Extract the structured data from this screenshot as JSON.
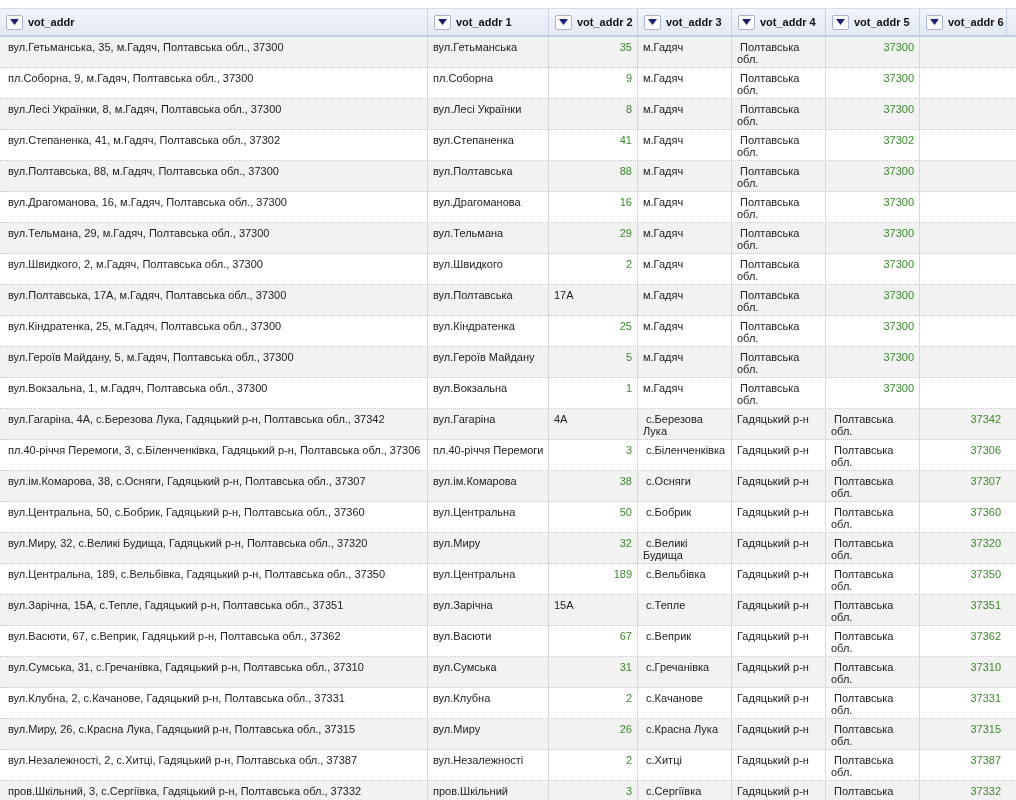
{
  "table": {
    "columns": [
      "vot_addr",
      "vot_addr 1",
      "vot_addr 2",
      "vot_addr 3",
      "vot_addr 4",
      "vot_addr 5",
      "vot_addr 6"
    ],
    "rows": [
      {
        "cells": [
          {
            "text": "вул.Гетьманська, 35, м.Гадяч, Полтавська обл., 37300",
            "kind": "text"
          },
          {
            "text": "вул.Гетьманська",
            "kind": "text"
          },
          {
            "text": "35",
            "kind": "number"
          },
          {
            "text": "м.Гадяч",
            "kind": "text"
          },
          {
            "text": " Полтавська обл.",
            "kind": "text"
          },
          {
            "text": "37300",
            "kind": "number"
          },
          null
        ]
      },
      {
        "cells": [
          {
            "text": "пл.Соборна, 9, м.Гадяч, Полтавська обл., 37300",
            "kind": "text"
          },
          {
            "text": "пл.Соборна",
            "kind": "text"
          },
          {
            "text": "9",
            "kind": "number"
          },
          {
            "text": "м.Гадяч",
            "kind": "text"
          },
          {
            "text": " Полтавська обл.",
            "kind": "text"
          },
          {
            "text": "37300",
            "kind": "number"
          },
          null
        ]
      },
      {
        "cells": [
          {
            "text": "вул.Лесі Українки, 8, м.Гадяч, Полтавська обл., 37300",
            "kind": "text"
          },
          {
            "text": "вул.Лесі Українки",
            "kind": "text"
          },
          {
            "text": "8",
            "kind": "number"
          },
          {
            "text": "м.Гадяч",
            "kind": "text"
          },
          {
            "text": " Полтавська обл.",
            "kind": "text"
          },
          {
            "text": "37300",
            "kind": "number"
          },
          null
        ]
      },
      {
        "cells": [
          {
            "text": "вул.Степаненка, 41, м.Гадяч, Полтавська обл., 37302",
            "kind": "text"
          },
          {
            "text": "вул.Степаненка",
            "kind": "text"
          },
          {
            "text": "41",
            "kind": "number"
          },
          {
            "text": "м.Гадяч",
            "kind": "text"
          },
          {
            "text": " Полтавська обл.",
            "kind": "text"
          },
          {
            "text": "37302",
            "kind": "number"
          },
          null
        ]
      },
      {
        "cells": [
          {
            "text": "вул.Полтавська, 88, м.Гадяч, Полтавська обл., 37300",
            "kind": "text"
          },
          {
            "text": "вул.Полтавська",
            "kind": "text"
          },
          {
            "text": "88",
            "kind": "number"
          },
          {
            "text": "м.Гадяч",
            "kind": "text"
          },
          {
            "text": " Полтавська обл.",
            "kind": "text"
          },
          {
            "text": "37300",
            "kind": "number"
          },
          null
        ]
      },
      {
        "cells": [
          {
            "text": "вул.Драгоманова, 16, м.Гадяч, Полтавська обл., 37300",
            "kind": "text"
          },
          {
            "text": "вул.Драгоманова",
            "kind": "text"
          },
          {
            "text": "16",
            "kind": "number"
          },
          {
            "text": "м.Гадяч",
            "kind": "text"
          },
          {
            "text": " Полтавська обл.",
            "kind": "text"
          },
          {
            "text": "37300",
            "kind": "number"
          },
          null
        ]
      },
      {
        "cells": [
          {
            "text": "вул.Тельмана, 29, м.Гадяч, Полтавська обл., 37300",
            "kind": "text"
          },
          {
            "text": "вул.Тельмана",
            "kind": "text"
          },
          {
            "text": "29",
            "kind": "number"
          },
          {
            "text": "м.Гадяч",
            "kind": "text"
          },
          {
            "text": " Полтавська обл.",
            "kind": "text"
          },
          {
            "text": "37300",
            "kind": "number"
          },
          null
        ]
      },
      {
        "cells": [
          {
            "text": "вул.Швидкого, 2, м.Гадяч, Полтавська обл., 37300",
            "kind": "text"
          },
          {
            "text": "вул.Швидкого",
            "kind": "text"
          },
          {
            "text": "2",
            "kind": "number"
          },
          {
            "text": "м.Гадяч",
            "kind": "text"
          },
          {
            "text": " Полтавська обл.",
            "kind": "text"
          },
          {
            "text": "37300",
            "kind": "number"
          },
          null
        ]
      },
      {
        "cells": [
          {
            "text": "вул.Полтавська, 17А, м.Гадяч, Полтавська обл., 37300",
            "kind": "text"
          },
          {
            "text": "вул.Полтавська",
            "kind": "text"
          },
          {
            "text": "17А",
            "kind": "text"
          },
          {
            "text": "м.Гадяч",
            "kind": "text"
          },
          {
            "text": " Полтавська обл.",
            "kind": "text"
          },
          {
            "text": "37300",
            "kind": "number"
          },
          null
        ]
      },
      {
        "cells": [
          {
            "text": "вул.Кіндратенка, 25, м.Гадяч, Полтавська обл., 37300",
            "kind": "text"
          },
          {
            "text": "вул.Кіндратенка",
            "kind": "text"
          },
          {
            "text": "25",
            "kind": "number"
          },
          {
            "text": "м.Гадяч",
            "kind": "text"
          },
          {
            "text": " Полтавська обл.",
            "kind": "text"
          },
          {
            "text": "37300",
            "kind": "number"
          },
          null
        ]
      },
      {
        "cells": [
          {
            "text": "вул.Героїв Майдану, 5, м.Гадяч, Полтавська обл., 37300",
            "kind": "text"
          },
          {
            "text": "вул.Героїв Майдану",
            "kind": "text"
          },
          {
            "text": "5",
            "kind": "number"
          },
          {
            "text": "м.Гадяч",
            "kind": "text"
          },
          {
            "text": " Полтавська обл.",
            "kind": "text"
          },
          {
            "text": "37300",
            "kind": "number"
          },
          null
        ]
      },
      {
        "cells": [
          {
            "text": "вул.Вокзальна, 1, м.Гадяч, Полтавська обл., 37300",
            "kind": "text"
          },
          {
            "text": "вул.Вокзальна",
            "kind": "text"
          },
          {
            "text": "1",
            "kind": "number"
          },
          {
            "text": "м.Гадяч",
            "kind": "text"
          },
          {
            "text": " Полтавська обл.",
            "kind": "text"
          },
          {
            "text": "37300",
            "kind": "number"
          },
          null
        ]
      },
      {
        "cells": [
          {
            "text": "вул.Гагаріна, 4А, с.Березова Лука, Гадяцький р-н, Полтавська обл., 37342",
            "kind": "text"
          },
          {
            "text": "вул.Гагаріна",
            "kind": "text"
          },
          {
            "text": "4А",
            "kind": "text"
          },
          {
            "text": " с.Березова Лука",
            "kind": "text"
          },
          {
            "text": "Гадяцький р-н",
            "kind": "text"
          },
          {
            "text": " Полтавська обл.",
            "kind": "text"
          },
          {
            "text": "37342",
            "kind": "number"
          }
        ]
      },
      {
        "cells": [
          {
            "text": "пл.40-річчя Перемоги, 3, с.Біленченківка, Гадяцький р-н, Полтавська обл., 37306",
            "kind": "text"
          },
          {
            "text": "пл.40-річчя Перемоги",
            "kind": "text"
          },
          {
            "text": "3",
            "kind": "number"
          },
          {
            "text": " с.Біленченківка",
            "kind": "text"
          },
          {
            "text": "Гадяцький р-н",
            "kind": "text"
          },
          {
            "text": " Полтавська обл.",
            "kind": "text"
          },
          {
            "text": "37306",
            "kind": "number"
          }
        ]
      },
      {
        "cells": [
          {
            "text": "вул.ім.Комарова, 38, с.Осняги, Гадяцький р-н, Полтавська обл., 37307",
            "kind": "text"
          },
          {
            "text": "вул.ім.Комарова",
            "kind": "text"
          },
          {
            "text": "38",
            "kind": "number"
          },
          {
            "text": " с.Осняги",
            "kind": "text"
          },
          {
            "text": "Гадяцький р-н",
            "kind": "text"
          },
          {
            "text": " Полтавська обл.",
            "kind": "text"
          },
          {
            "text": "37307",
            "kind": "number"
          }
        ]
      },
      {
        "cells": [
          {
            "text": "вул.Центральна, 50, с.Бобрик, Гадяцький р-н, Полтавська обл., 37360",
            "kind": "text"
          },
          {
            "text": "вул.Центральна",
            "kind": "text"
          },
          {
            "text": "50",
            "kind": "number"
          },
          {
            "text": " с.Бобрик",
            "kind": "text"
          },
          {
            "text": "Гадяцький р-н",
            "kind": "text"
          },
          {
            "text": " Полтавська обл.",
            "kind": "text"
          },
          {
            "text": "37360",
            "kind": "number"
          }
        ]
      },
      {
        "cells": [
          {
            "text": "вул.Миру, 32, с.Великі Будища, Гадяцький р-н, Полтавська обл., 37320",
            "kind": "text"
          },
          {
            "text": "вул.Миру",
            "kind": "text"
          },
          {
            "text": "32",
            "kind": "number"
          },
          {
            "text": " с.Великі Будища",
            "kind": "text"
          },
          {
            "text": "Гадяцький р-н",
            "kind": "text"
          },
          {
            "text": " Полтавська обл.",
            "kind": "text"
          },
          {
            "text": "37320",
            "kind": "number"
          }
        ]
      },
      {
        "cells": [
          {
            "text": "вул.Центральна, 189, с.Вельбівка, Гадяцький р-н, Полтавська обл., 37350",
            "kind": "text"
          },
          {
            "text": "вул.Центральна",
            "kind": "text"
          },
          {
            "text": "189",
            "kind": "number"
          },
          {
            "text": " с.Вельбівка",
            "kind": "text"
          },
          {
            "text": "Гадяцький р-н",
            "kind": "text"
          },
          {
            "text": " Полтавська обл.",
            "kind": "text"
          },
          {
            "text": "37350",
            "kind": "number"
          }
        ]
      },
      {
        "cells": [
          {
            "text": "вул.Зарічна, 15А, с.Тепле, Гадяцький р-н, Полтавська обл., 37351",
            "kind": "text"
          },
          {
            "text": "вул.Зарічна",
            "kind": "text"
          },
          {
            "text": "15А",
            "kind": "text"
          },
          {
            "text": " с.Тепле",
            "kind": "text"
          },
          {
            "text": "Гадяцький р-н",
            "kind": "text"
          },
          {
            "text": " Полтавська обл.",
            "kind": "text"
          },
          {
            "text": "37351",
            "kind": "number"
          }
        ]
      },
      {
        "cells": [
          {
            "text": "вул.Васюти, 67, с.Веприк, Гадяцький р-н, Полтавська обл., 37362",
            "kind": "text"
          },
          {
            "text": "вул.Васюти",
            "kind": "text"
          },
          {
            "text": "67",
            "kind": "number"
          },
          {
            "text": " с.Веприк",
            "kind": "text"
          },
          {
            "text": "Гадяцький р-н",
            "kind": "text"
          },
          {
            "text": " Полтавська обл.",
            "kind": "text"
          },
          {
            "text": "37362",
            "kind": "number"
          }
        ]
      },
      {
        "cells": [
          {
            "text": "вул.Сумська, 31, с.Гречанівка, Гадяцький р-н, Полтавська обл., 37310",
            "kind": "text"
          },
          {
            "text": "вул.Сумська",
            "kind": "text"
          },
          {
            "text": "31",
            "kind": "number"
          },
          {
            "text": " с.Гречанівка",
            "kind": "text"
          },
          {
            "text": "Гадяцький р-н",
            "kind": "text"
          },
          {
            "text": " Полтавська обл.",
            "kind": "text"
          },
          {
            "text": "37310",
            "kind": "number"
          }
        ]
      },
      {
        "cells": [
          {
            "text": "вул.Клубна, 2, с.Качанове, Гадяцький р-н, Полтавська обл., 37331",
            "kind": "text"
          },
          {
            "text": "вул.Клубна",
            "kind": "text"
          },
          {
            "text": "2",
            "kind": "number"
          },
          {
            "text": " с.Качанове",
            "kind": "text"
          },
          {
            "text": "Гадяцький р-н",
            "kind": "text"
          },
          {
            "text": " Полтавська обл.",
            "kind": "text"
          },
          {
            "text": "37331",
            "kind": "number"
          }
        ]
      },
      {
        "cells": [
          {
            "text": "вул.Миру, 26, с.Красна Лука, Гадяцький р-н, Полтавська обл., 37315",
            "kind": "text"
          },
          {
            "text": "вул.Миру",
            "kind": "text"
          },
          {
            "text": "26",
            "kind": "number"
          },
          {
            "text": " с.Красна Лука",
            "kind": "text"
          },
          {
            "text": "Гадяцький р-н",
            "kind": "text"
          },
          {
            "text": " Полтавська обл.",
            "kind": "text"
          },
          {
            "text": "37315",
            "kind": "number"
          }
        ]
      },
      {
        "cells": [
          {
            "text": "вул.Незалежності, 2, с.Хитці, Гадяцький р-н, Полтавська обл., 37387",
            "kind": "text"
          },
          {
            "text": "вул.Незалежності",
            "kind": "text"
          },
          {
            "text": "2",
            "kind": "number"
          },
          {
            "text": " с.Хитці",
            "kind": "text"
          },
          {
            "text": "Гадяцький р-н",
            "kind": "text"
          },
          {
            "text": " Полтавська обл.",
            "kind": "text"
          },
          {
            "text": "37387",
            "kind": "number"
          }
        ]
      },
      {
        "cells": [
          {
            "text": "пров.Шкільний, 3, с.Сергіївка, Гадяцький р-н, Полтавська обл., 37332",
            "kind": "text"
          },
          {
            "text": "пров.Шкільний",
            "kind": "text"
          },
          {
            "text": "3",
            "kind": "number"
          },
          {
            "text": " с.Сергіївка",
            "kind": "text"
          },
          {
            "text": "Гадяцький р-н",
            "kind": "text"
          },
          {
            "text": " Полтавська",
            "kind": "text"
          },
          {
            "text": "37332",
            "kind": "number"
          }
        ]
      }
    ]
  }
}
